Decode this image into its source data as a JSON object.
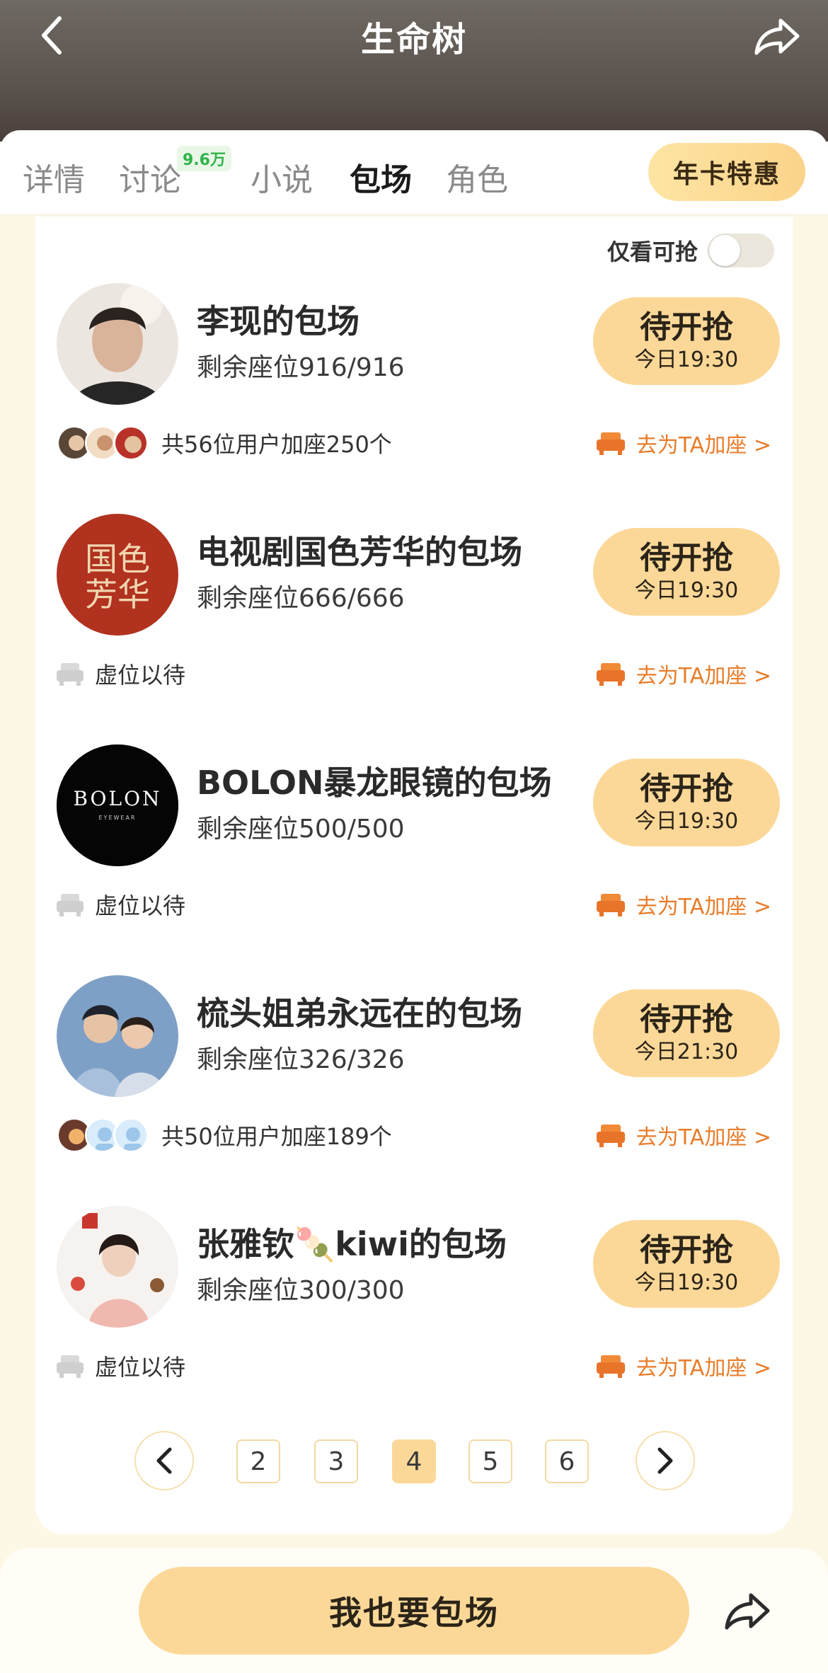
{
  "header": {
    "title": "生命树",
    "back_icon": "chevron-left-icon",
    "share_icon": "share-arrow-icon"
  },
  "tabs": [
    {
      "label": "详情",
      "active": false
    },
    {
      "label": "讨论",
      "active": false,
      "badge": "9.6万"
    },
    {
      "label": "小说",
      "active": false
    },
    {
      "label": "包场",
      "active": true
    },
    {
      "label": "角色",
      "active": false
    }
  ],
  "vip_button": {
    "label": "年卡特惠"
  },
  "filter": {
    "label": "仅看可抢",
    "enabled": false
  },
  "items": [
    {
      "name": "李现的包场",
      "seats": "剩余座位916/916",
      "button_main": "待开抢",
      "button_time": "今日19:30",
      "footer_text": "共56位用户加座250个",
      "footer_type": "users",
      "add_seat": "去为TA加座 >"
    },
    {
      "name": "电视剧国色芳华的包场",
      "seats": "剩余座位666/666",
      "button_main": "待开抢",
      "button_time": "今日19:30",
      "footer_text": "虚位以待",
      "footer_type": "empty",
      "add_seat": "去为TA加座 >"
    },
    {
      "name": "BOLON暴龙眼镜的包场",
      "seats": "剩余座位500/500",
      "button_main": "待开抢",
      "button_time": "今日19:30",
      "footer_text": "虚位以待",
      "footer_type": "empty",
      "add_seat": "去为TA加座 >",
      "logo_text": "BOLON",
      "logo_sub": "EYEWEAR"
    },
    {
      "name": "梳头姐弟永远在的包场",
      "seats": "剩余座位326/326",
      "button_main": "待开抢",
      "button_time": "今日21:30",
      "footer_text": "共50位用户加座189个",
      "footer_type": "users",
      "add_seat": "去为TA加座 >"
    },
    {
      "name": "张雅钦🍡kiwi的包场",
      "seats": "剩余座位300/300",
      "button_main": "待开抢",
      "button_time": "今日19:30",
      "footer_text": "虚位以待",
      "footer_type": "empty",
      "add_seat": "去为TA加座 >"
    }
  ],
  "pagination": {
    "pages": [
      "2",
      "3",
      "4",
      "5",
      "6"
    ],
    "current": "4"
  },
  "bottom": {
    "cta_label": "我也要包场"
  },
  "colors": {
    "accent": "#fcd898",
    "orange_text": "#e87c2a",
    "badge_green": "#2fb34a",
    "page_bg": "#fdf8e6"
  }
}
